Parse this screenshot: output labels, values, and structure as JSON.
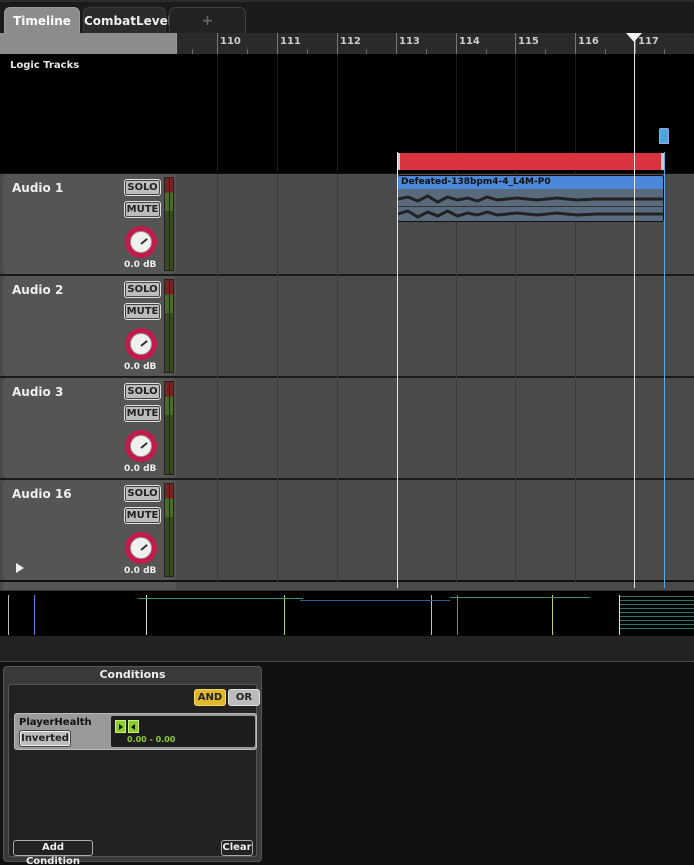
{
  "tabs": [
    {
      "label": "Timeline",
      "active": true
    },
    {
      "label": "CombatLevel",
      "active": false
    },
    {
      "label": "+",
      "active": false
    }
  ],
  "ruler": {
    "bars": [
      "110",
      "111",
      "112",
      "113",
      "114",
      "115",
      "116",
      "117"
    ]
  },
  "logic_tracks": {
    "label": "Logic Tracks"
  },
  "tracks": [
    {
      "name": "Audio 1",
      "solo": "SOLO",
      "mute": "MUTE",
      "volume": "0.0 dB"
    },
    {
      "name": "Audio 2",
      "solo": "SOLO",
      "mute": "MUTE",
      "volume": "0.0 dB"
    },
    {
      "name": "Audio 3",
      "solo": "SOLO",
      "mute": "MUTE",
      "volume": "0.0 dB"
    },
    {
      "name": "Audio 16",
      "solo": "SOLO",
      "mute": "MUTE",
      "volume": "0.0 dB"
    }
  ],
  "clip": {
    "title": "Defeated-138bpm4-4_L4M-P0"
  },
  "colors": {
    "region_red": "#d8333e",
    "clip_blue": "#4b88d8",
    "knob_red": "#c31a4b",
    "condition_green": "#8dcc2d",
    "and_yellow": "#e0b92a"
  },
  "conditions": {
    "title": "Conditions",
    "and_label": "AND",
    "or_label": "OR",
    "items": [
      {
        "name": "PlayerHealth",
        "inverted_label": "Inverted",
        "range": "0.00 - 0.00"
      }
    ],
    "add_label": "Add Condition",
    "clear_label": "Clear"
  }
}
